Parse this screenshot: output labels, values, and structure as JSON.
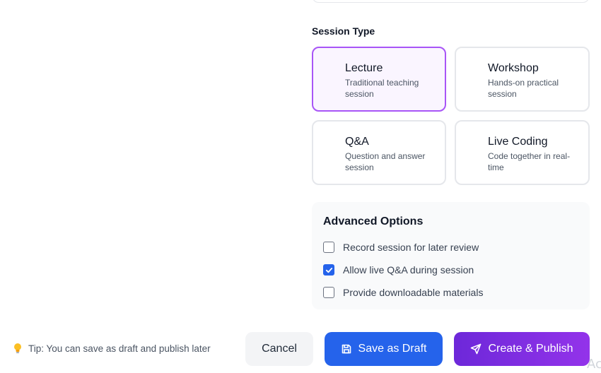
{
  "session_type": {
    "label": "Session Type",
    "options": [
      {
        "title": "Lecture",
        "description": "Traditional teaching session",
        "selected": true
      },
      {
        "title": "Workshop",
        "description": "Hands-on practical session",
        "selected": false
      },
      {
        "title": "Q&A",
        "description": "Question and answer session",
        "selected": false
      },
      {
        "title": "Live Coding",
        "description": "Code together in real-time",
        "selected": false
      }
    ]
  },
  "advanced": {
    "title": "Advanced Options",
    "options": [
      {
        "label": "Record session for later review",
        "checked": false
      },
      {
        "label": "Allow live Q&A during session",
        "checked": true
      },
      {
        "label": "Provide downloadable materials",
        "checked": false
      }
    ]
  },
  "footer": {
    "tip": "Tip: You can save as draft and publish later",
    "cancel_label": "Cancel",
    "draft_label": "Save as Draft",
    "publish_label": "Create & Publish"
  },
  "watermark": "Ac",
  "colors": {
    "accent_purple": "#a855f7",
    "primary_blue": "#2563eb",
    "publish_gradient_start": "#6d28d9",
    "publish_gradient_end": "#9333ea"
  },
  "icons": {
    "tip": "lightbulb-icon",
    "draft": "save-icon",
    "publish": "send-icon",
    "checkbox": "checkmark-icon"
  }
}
